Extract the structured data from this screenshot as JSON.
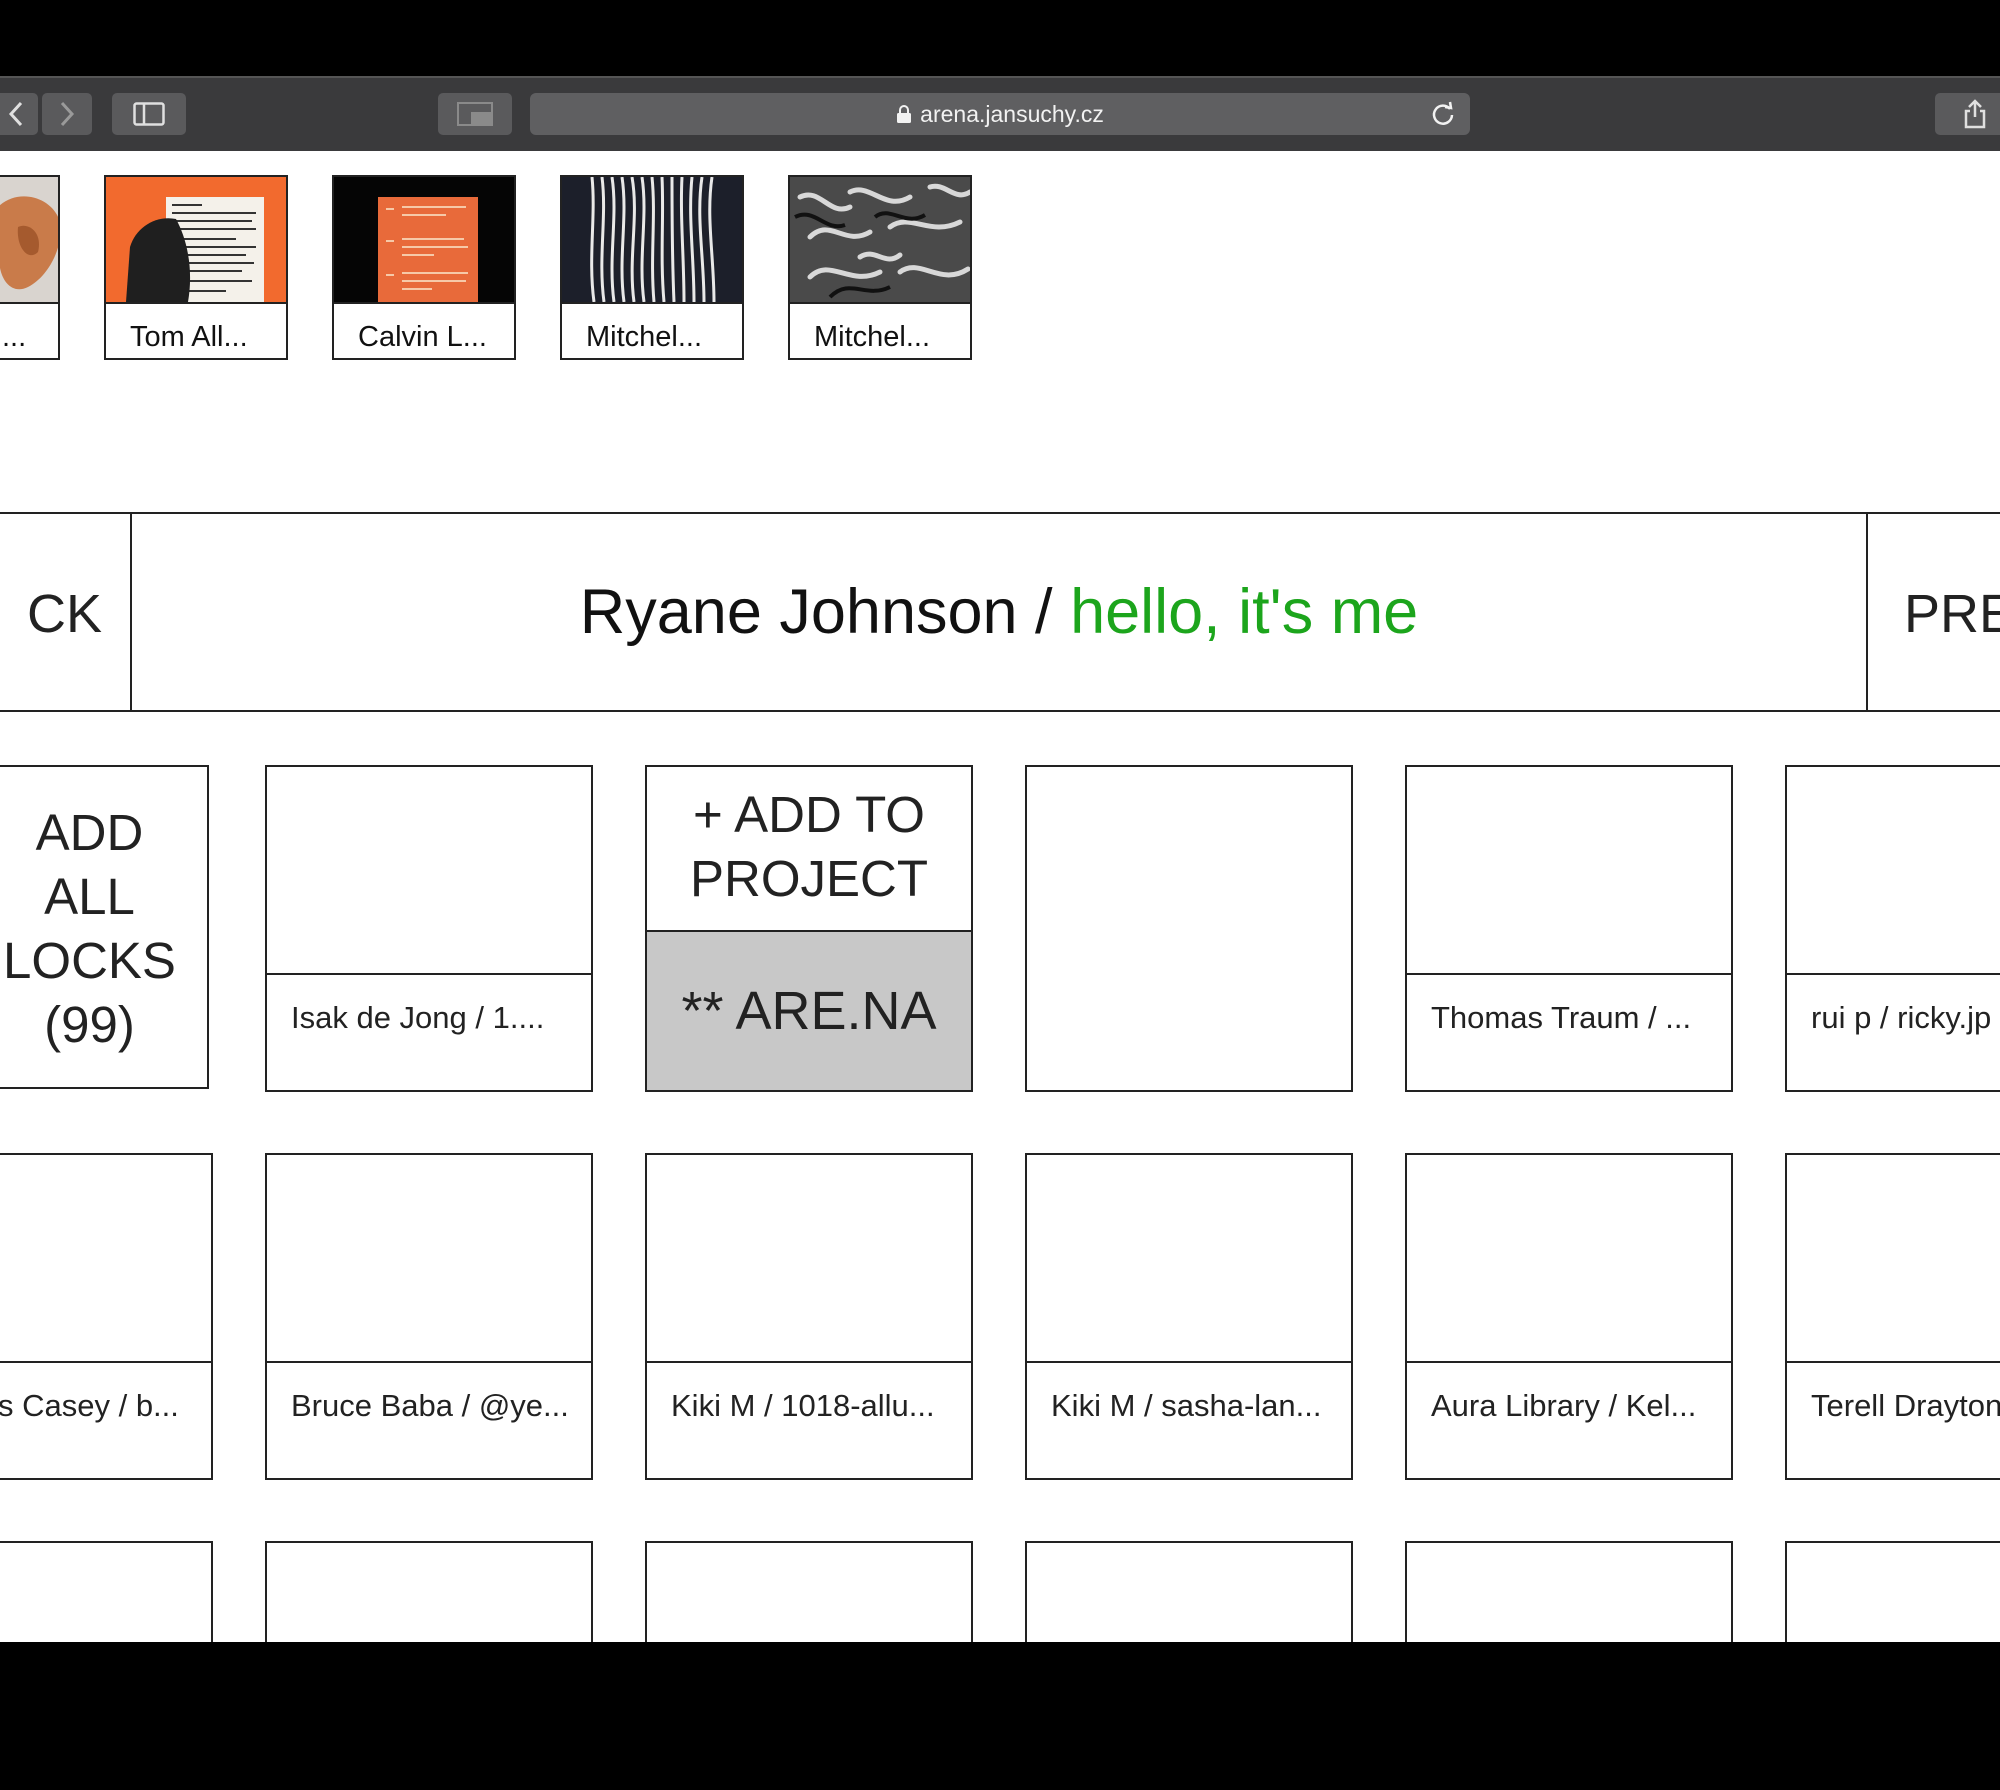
{
  "browser": {
    "url": "arena.jansuchy.cz"
  },
  "thumbnails": [
    {
      "caption": "..."
    },
    {
      "caption": "Tom All..."
    },
    {
      "caption": "Calvin L..."
    },
    {
      "caption": "Mitchel..."
    },
    {
      "caption": "Mitchel..."
    }
  ],
  "header": {
    "back_label": "CK",
    "user": "Ryane Johnson / ",
    "channel": "hello, it's me",
    "prev_label": "PRE",
    "accent_color": "#1ca51c"
  },
  "actions": {
    "add_all": "ADD ALL LOCKS (99)",
    "add_all_lines": [
      "ADD",
      "ALL",
      "LOCKS",
      "(99)"
    ],
    "add_to_project": "+ ADD TO PROJECT",
    "add_to_project_lines": [
      "+ ADD TO",
      "PROJECT"
    ],
    "arena": "** ARE.NA"
  },
  "row1": [
    {
      "caption": "Isak de Jong / 1...."
    },
    {
      "caption": ""
    },
    {
      "caption": "Thomas Traum / ..."
    },
    {
      "caption": "rui p / ricky.jp"
    }
  ],
  "row2": [
    {
      "caption": "s Casey / b..."
    },
    {
      "caption": "Bruce Baba / @ye..."
    },
    {
      "caption": "Kiki M / 1018-allu..."
    },
    {
      "caption": "Kiki M / sasha-lan..."
    },
    {
      "caption": "Aura Library / Kel..."
    },
    {
      "caption": "Terell Drayton"
    }
  ]
}
